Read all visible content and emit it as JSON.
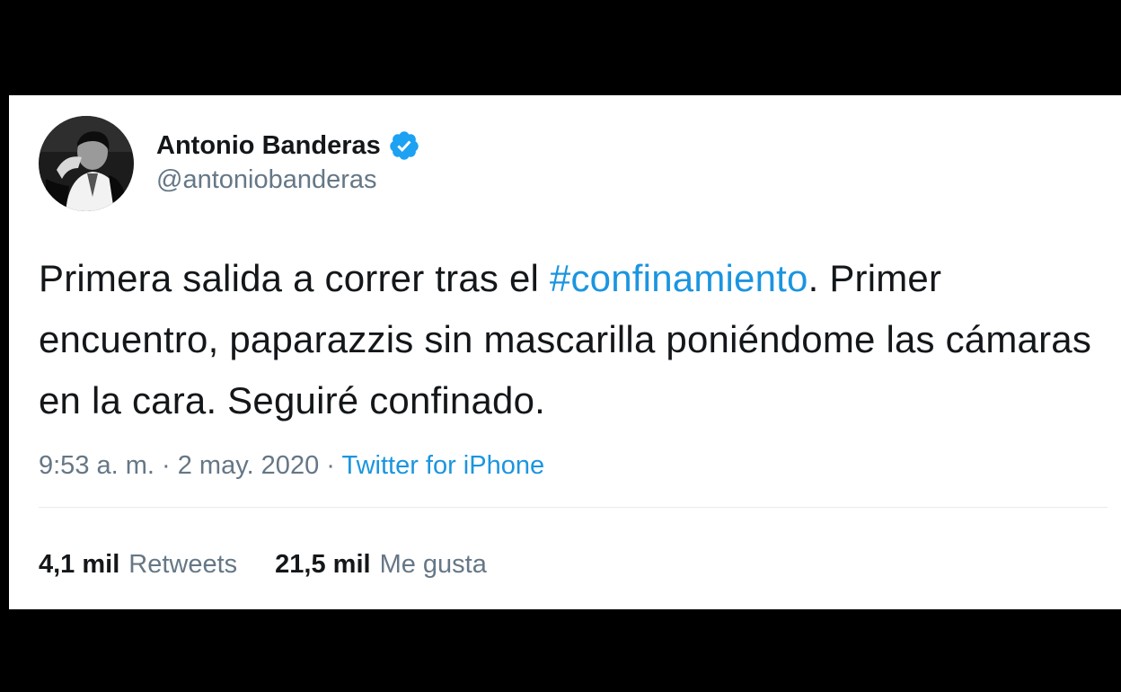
{
  "tweet": {
    "author": {
      "display_name": "Antonio Banderas",
      "handle": "@antoniobanderas",
      "verified": true,
      "avatar_icon": "profile-photo"
    },
    "text": {
      "part1": "Primera salida a correr tras el ",
      "hashtag": "#confinamiento",
      "part2": ". Primer encuentro, paparazzis sin mascarilla poniéndome las cámaras en la cara. Seguiré confinado."
    },
    "meta": {
      "time": "9:53 a. m.",
      "separator1": " · ",
      "date": "2 may. 2020",
      "separator2": " · ",
      "source": "Twitter for iPhone"
    },
    "stats": {
      "retweets_count": "4,1 mil",
      "retweets_label": "Retweets",
      "likes_count": "21,5 mil",
      "likes_label": "Me gusta"
    }
  },
  "colors": {
    "background": "#000000",
    "card": "#ffffff",
    "text_primary": "#14171a",
    "text_secondary": "#657786",
    "link": "#1b95e0",
    "verified_badge": "#1da1f2",
    "divider": "#e6ecf0"
  }
}
